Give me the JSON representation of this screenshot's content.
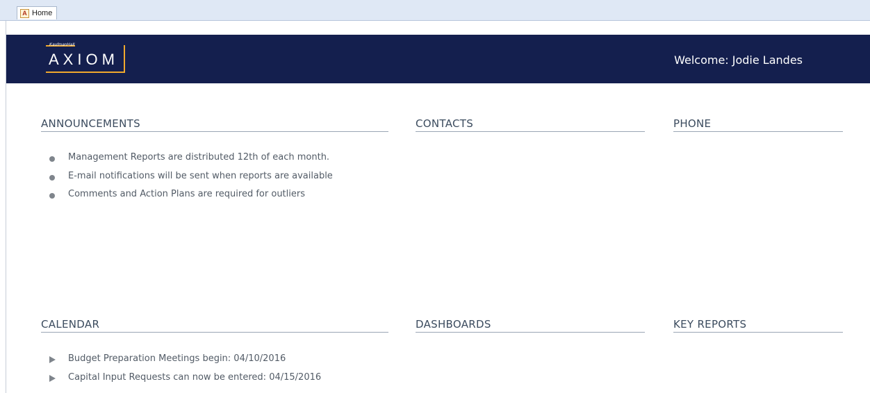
{
  "tab": {
    "label": "Home",
    "icon": "axiom-app-icon",
    "icon_letter": "A"
  },
  "header": {
    "brand_sub": "KaufmanHall",
    "brand": "AXIOM",
    "welcome": "Welcome: Jodie Landes"
  },
  "sections": {
    "announcements": {
      "title": "ANNOUNCEMENTS",
      "items": [
        "Management Reports are distributed 12th of each month.",
        "E-mail notifications will be sent when reports are available",
        "Comments and Action Plans are required for outliers"
      ]
    },
    "contacts": {
      "title": "CONTACTS"
    },
    "phone": {
      "title": "PHONE"
    },
    "calendar": {
      "title": "CALENDAR",
      "items": [
        "Budget Preparation Meetings begin: 04/10/2016",
        "Capital Input Requests can now be entered: 04/15/2016"
      ]
    },
    "dashboards": {
      "title": "DASHBOARDS"
    },
    "key_reports": {
      "title": "KEY REPORTS"
    }
  },
  "colors": {
    "banner": "#141f4e",
    "accent": "#f0a92d",
    "heading_text": "#3b4b5e",
    "body_text": "#525b66"
  }
}
